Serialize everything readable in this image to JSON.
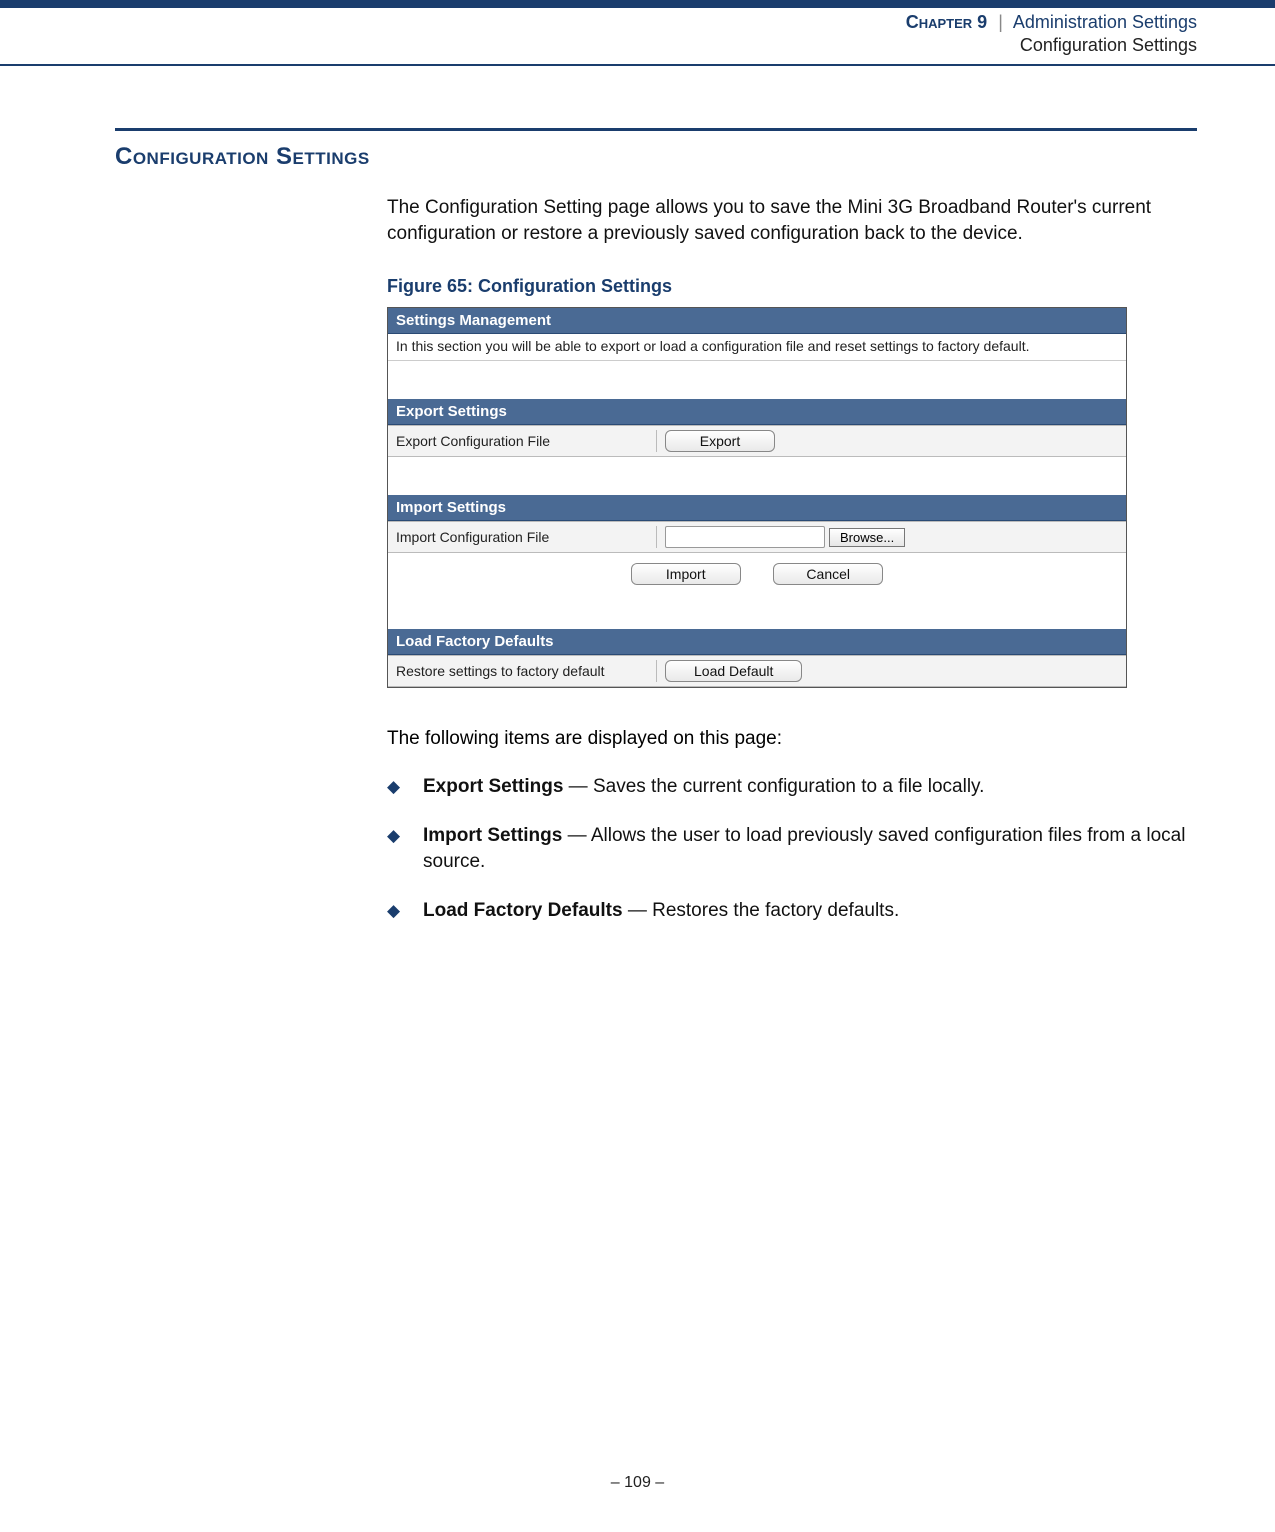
{
  "header": {
    "chapter_label": "Chapter 9",
    "divider": "|",
    "title": "Administration Settings",
    "subtitle": "Configuration Settings"
  },
  "section": {
    "heading": "Configuration Settings",
    "intro": "The Configuration Setting page allows you to save the Mini 3G Broadband Router's current configuration or restore a previously saved configuration back to the device."
  },
  "figure": {
    "caption": "Figure 65:  Configuration Settings",
    "panel_title": "Settings Management",
    "panel_desc": "In this section you will be able to export or load a configuration file and reset settings to factory default.",
    "export_heading": "Export Settings",
    "export_label": "Export Configuration File",
    "export_button": "Export",
    "import_heading": "Import Settings",
    "import_label": "Import Configuration File",
    "browse_button": "Browse...",
    "import_button": "Import",
    "cancel_button": "Cancel",
    "defaults_heading": "Load Factory Defaults",
    "defaults_label": "Restore settings to factory default",
    "defaults_button": "Load Default"
  },
  "items_intro": "The following items are displayed on this page:",
  "items": [
    {
      "name": "Export Settings",
      "desc": " — Saves the current configuration to a file locally."
    },
    {
      "name": "Import Settings",
      "desc": " — Allows the user to load previously saved configuration files from a local source."
    },
    {
      "name": "Load Factory Defaults",
      "desc": " — Restores the factory defaults."
    }
  ],
  "footer": {
    "page": "–  109  –"
  }
}
